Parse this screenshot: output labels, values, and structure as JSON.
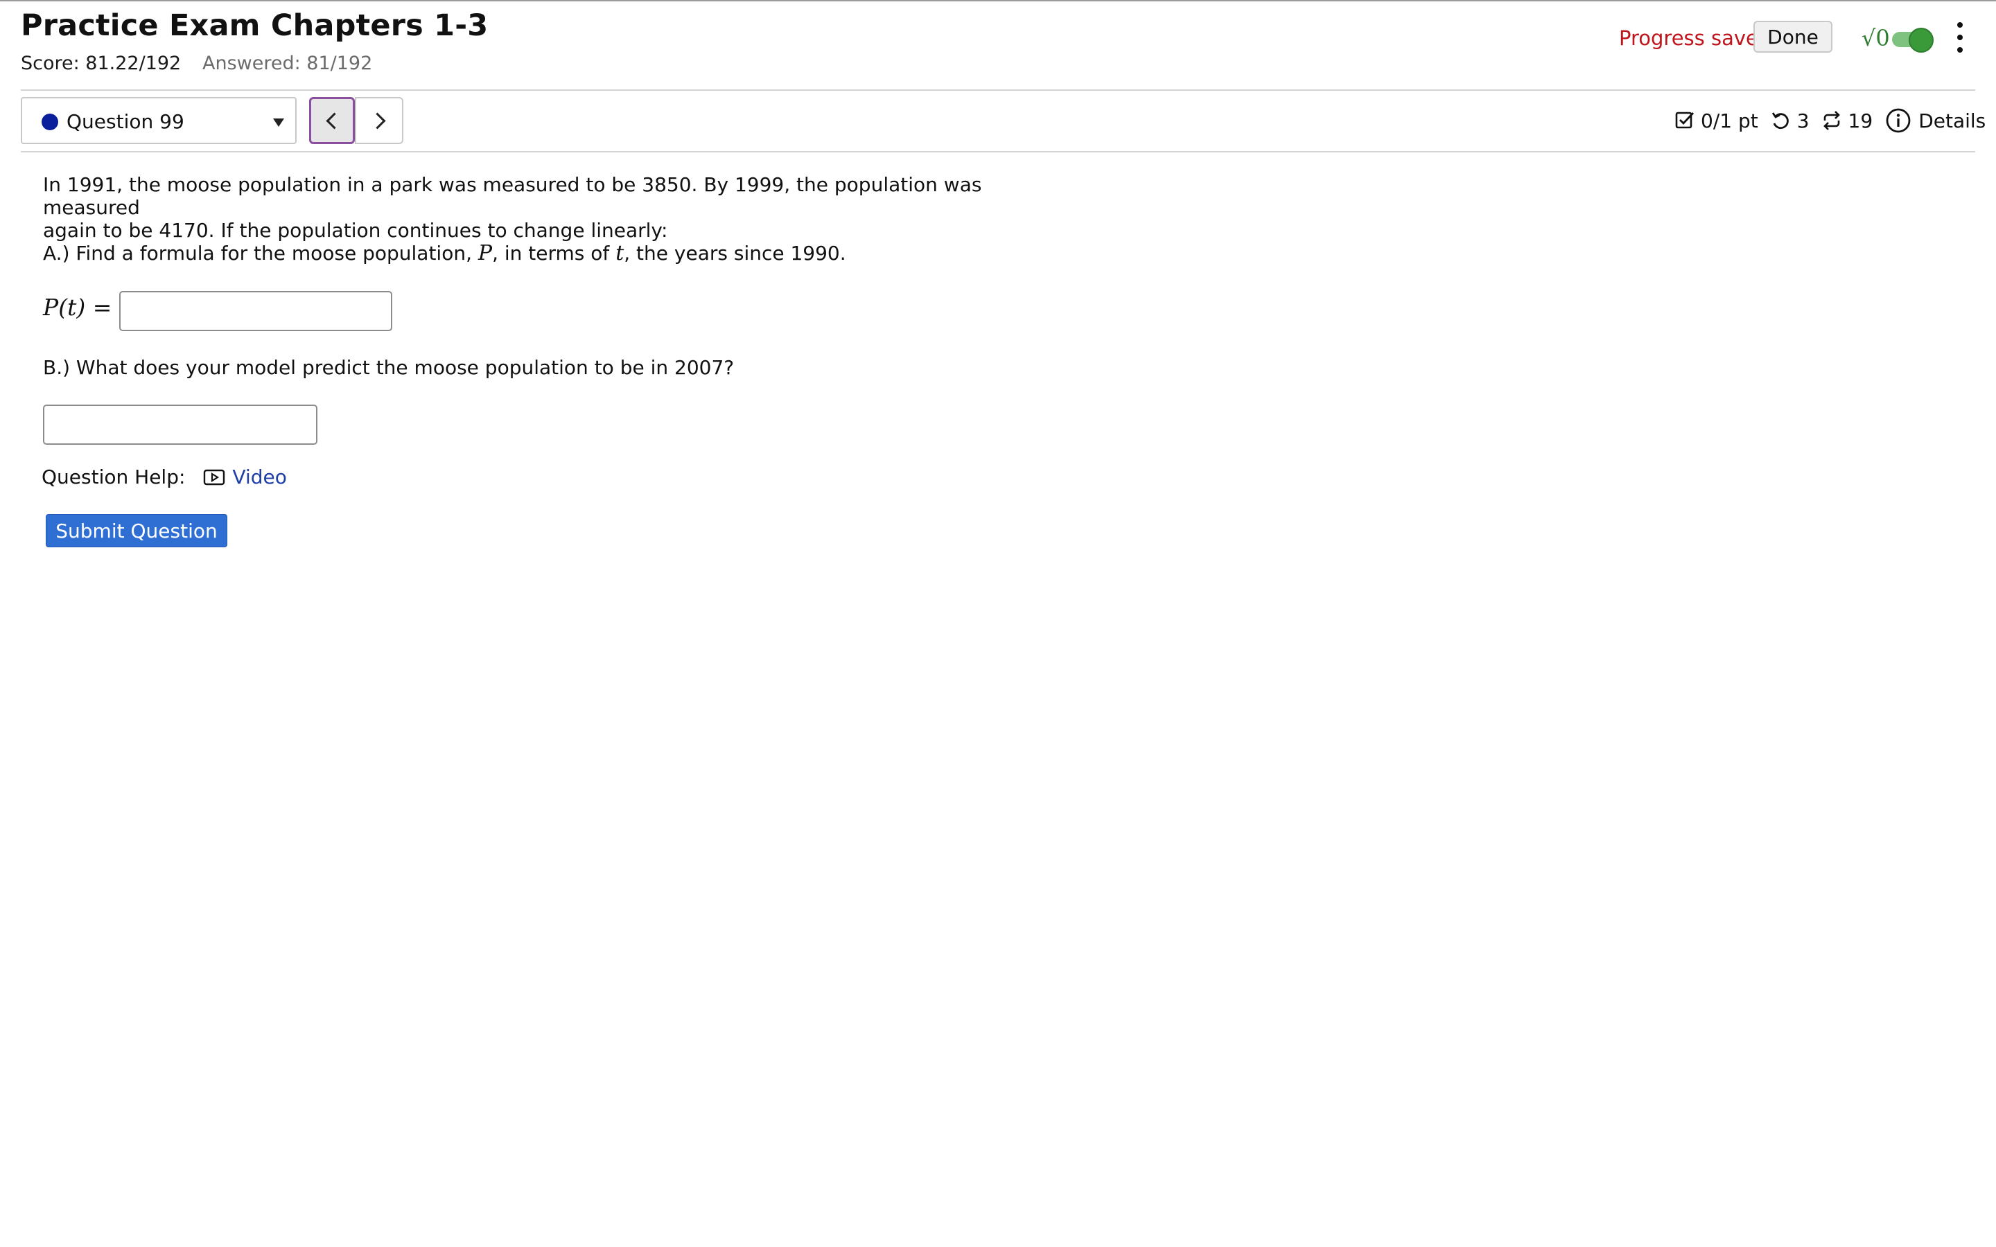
{
  "header": {
    "title": "Practice Exam Chapters 1-3",
    "score": "Score: 81.22/192",
    "answered": "Answered: 81/192",
    "progress_status": "Progress saved",
    "done_label": "Done",
    "math_toggle_icon": "sqrt-icon",
    "math_toggle_on": true,
    "more_menu_icon": "kebab-icon"
  },
  "nav": {
    "question_select_value": "Question 99",
    "status_dot_color": "#0b1f9c",
    "prev_icon": "chevron-left-icon",
    "next_icon": "chevron-right-icon"
  },
  "meta": {
    "points": "0/1 pt",
    "retries": "3",
    "attempts": "19",
    "details_label": "Details"
  },
  "question": {
    "body_line1": "In 1991, the moose population in a park was measured to be 3850. By 1999, the population was measured",
    "body_line2": "again to be 4170. If the population continues to change linearly:",
    "part_a_prefix": "A.) Find a formula for the moose population, ",
    "part_a_var_p": "P",
    "part_a_mid": ", in terms of ",
    "part_a_var_t": "t",
    "part_a_suffix": ", the years since 1990.",
    "formula_label": "P(t) =",
    "answer_a_value": "",
    "part_b": "B.) What does your model predict the moose population to be in 2007?",
    "answer_b_value": ""
  },
  "help": {
    "label": "Question Help:",
    "video_label": "Video"
  },
  "submit_label": "Submit Question",
  "colors": {
    "accent_blue": "#2f6fd4",
    "saved_red": "#c0141c",
    "toggle_green": "#3a9a3a",
    "focus_purple": "#8a4f9e"
  }
}
